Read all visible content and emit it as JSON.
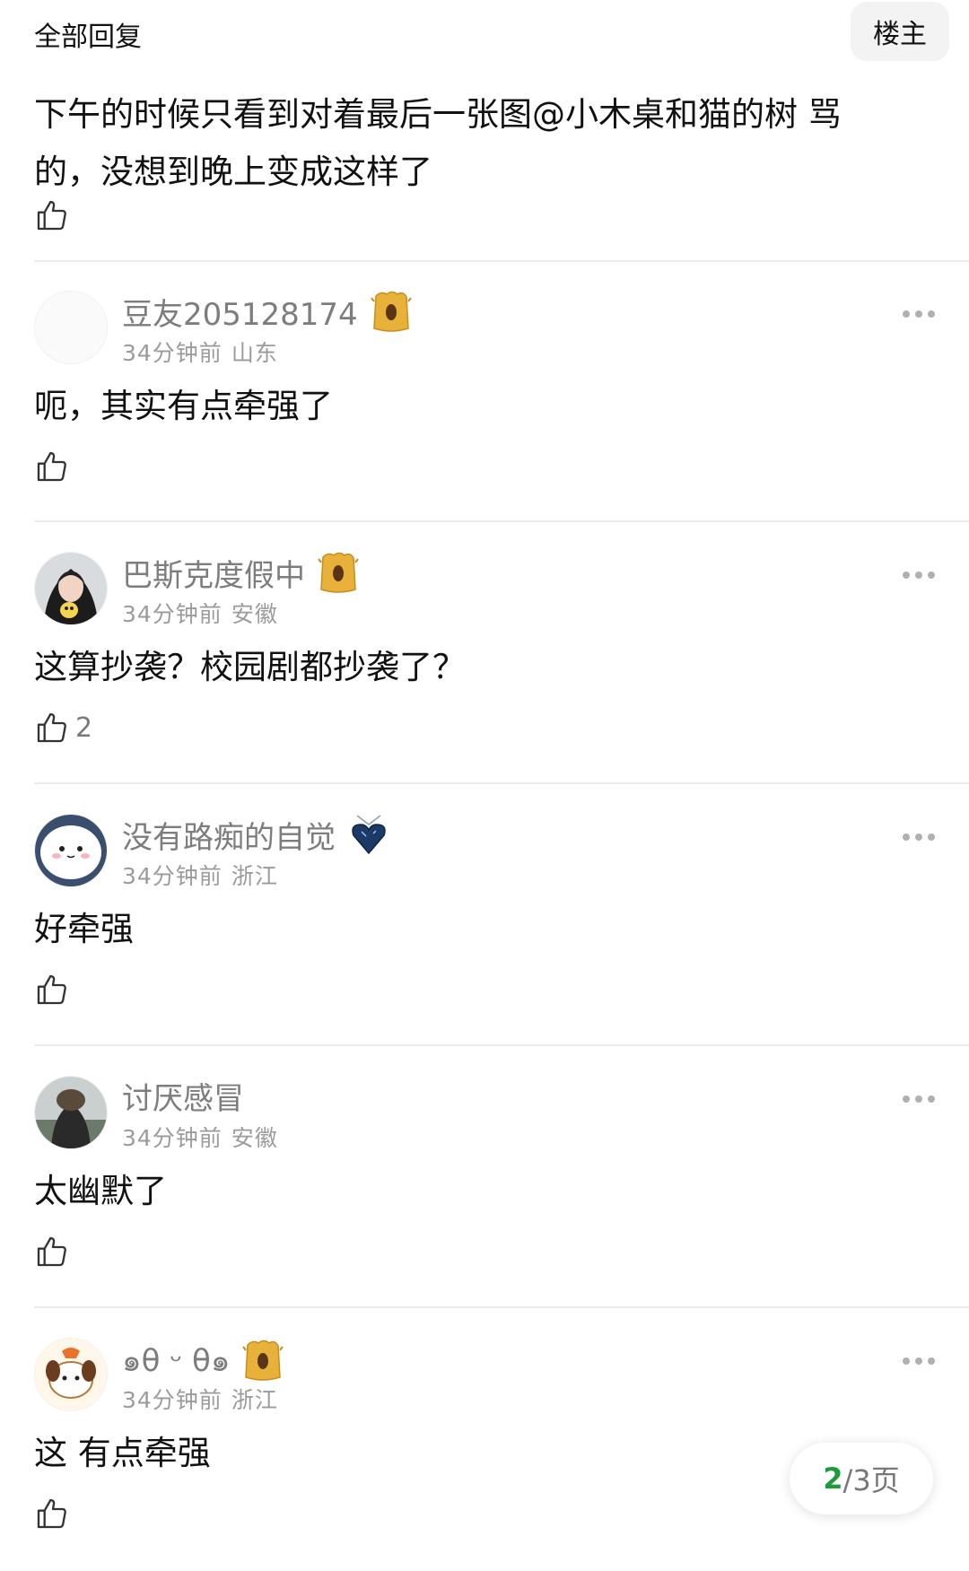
{
  "header": {
    "title": "全部回复",
    "owner_button": "楼主"
  },
  "top_comment": {
    "text": "下午的时候只看到对着最后一张图@小木桌和猫的树 骂的，没想到晚上变成这样了",
    "likes": ""
  },
  "replies": [
    {
      "name": "豆友205128174",
      "time": "34分钟前",
      "region": "山东",
      "text": "呃，其实有点牵强了",
      "likes": "",
      "badge": "stump-badge-icon"
    },
    {
      "name": "巴斯克度假中",
      "time": "34分钟前",
      "region": "安徽",
      "text": "这算抄袭？校园剧都抄袭了？",
      "likes": "2",
      "badge": "stump-badge-icon"
    },
    {
      "name": "没有路痴的自觉",
      "time": "34分钟前",
      "region": "浙江",
      "text": "好牵强",
      "likes": "",
      "badge": "heart-gem-badge-icon"
    },
    {
      "name": "讨厌感冒",
      "time": "34分钟前",
      "region": "安徽",
      "text": "太幽默了",
      "likes": "",
      "badge": ""
    },
    {
      "name": "๑θ ᵕ θ๑",
      "time": "34分钟前",
      "region": "浙江",
      "text": "这 有点牵强",
      "likes": "",
      "badge": "stump-badge-icon"
    }
  ],
  "pager": {
    "current": "2",
    "total": "/3页"
  },
  "colors": {
    "accent": "#1f9a3c",
    "meta": "#9b9b9b",
    "name": "#7d7d7d"
  }
}
